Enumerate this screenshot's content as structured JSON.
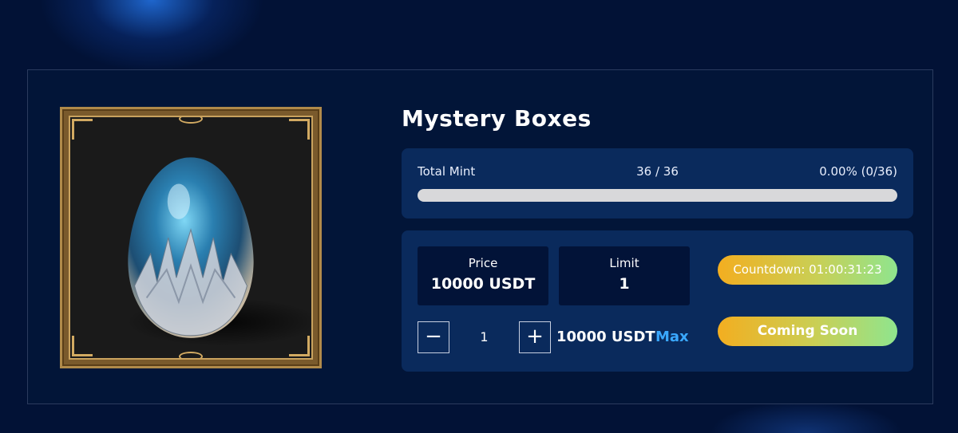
{
  "title": "Mystery Boxes",
  "mint": {
    "label": "Total Mint",
    "count": "36 / 36",
    "percent": "0.00% (0/36)",
    "progress_percent": 0
  },
  "price": {
    "label": "Price",
    "value": "10000 USDT"
  },
  "limit": {
    "label": "Limit",
    "value": "1"
  },
  "quantity": {
    "minus_symbol": "−",
    "plus_symbol": "+",
    "value": "1",
    "total": "10000 USDT",
    "max_label": "Max"
  },
  "countdown": "Countdown: 01:00:31:23",
  "action_label": "Coming Soon",
  "colors": {
    "background": "#021236",
    "card": "#0a2a5c",
    "stat_box": "#021338",
    "accent_blue": "#3aa8ff",
    "gradient_start": "#f3ae20",
    "gradient_end": "#8fe58e",
    "frame_gold": "#c9a25e"
  },
  "icons": {
    "minus": "minus-icon",
    "plus": "plus-icon",
    "artwork": "dragon-egg-image"
  }
}
